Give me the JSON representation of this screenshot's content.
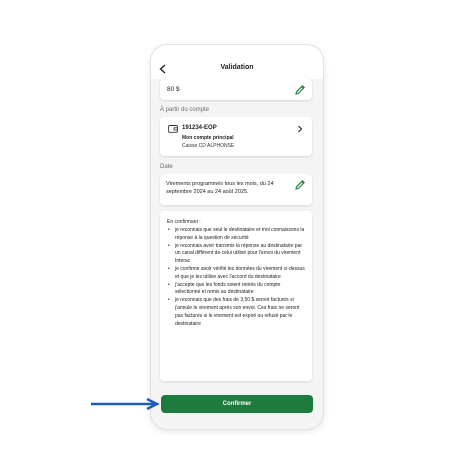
{
  "header": {
    "title": "Validation"
  },
  "amount": {
    "value": "80 $"
  },
  "from_account": {
    "label": "À partir du compte",
    "number": "191234-EOP",
    "name": "Mon compte principal",
    "institution": "Caisse CD ALPHONSE"
  },
  "date": {
    "label": "Date",
    "text": "Virements programmés tous les mois, du 24 septembre 2024 au 24 août 2025."
  },
  "confirmation": {
    "intro": "En confirmant :",
    "items": [
      "je reconnais que seul le destinataire et moi connaissons la réponse à la question de sécurité",
      "je reconnais avoir transmis la réponse au destinataire par un canal différent de celui utilisé pour l'envoi du virement Interac",
      "je confirme avoir vérifié les données du virement ci-dessus et que je les utilise avec l'accord du destinataire",
      "j'accepte que les fonds soient retirés du compte sélectionné et remis au destinataire",
      "je reconnais que des frais de 3,50 $ seront facturés si j'annule le virement après son envoi. Ces frais ne seront pas facturés si le virement est expiré ou refusé par le destinataire"
    ]
  },
  "button": {
    "confirm_label": "Confirmer"
  },
  "colors": {
    "accent": "#1f7a3d",
    "arrow": "#1e5bb8"
  }
}
